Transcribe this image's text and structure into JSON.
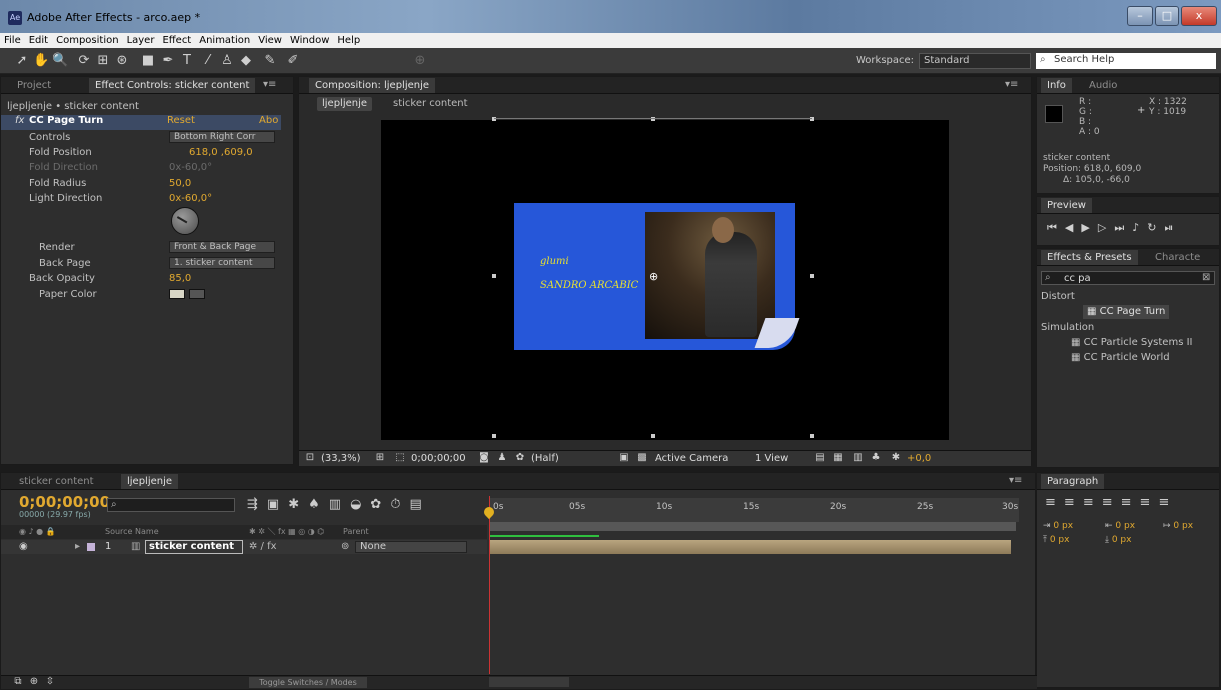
{
  "window": {
    "title": "Adobe After Effects - arco.aep *",
    "app_icon": "Ae"
  },
  "window_controls": {
    "minimize": "–",
    "maximize": "□",
    "close": "x"
  },
  "menu": [
    "File",
    "Edit",
    "Composition",
    "Layer",
    "Effect",
    "Animation",
    "View",
    "Window",
    "Help"
  ],
  "toolbar": {
    "workspace_label": "Workspace:",
    "workspace_value": "Standard",
    "search_placeholder": "Search Help"
  },
  "left_panel": {
    "tabs": [
      "Project",
      "Effect Controls: sticker content"
    ],
    "breadcrumb": "ljepljenje • sticker content",
    "effect": {
      "fx_label": "fx",
      "name": "CC Page Turn",
      "reset": "Reset",
      "about": "Abo"
    },
    "properties": [
      {
        "label": "Controls",
        "value": "Bottom Right Corr"
      },
      {
        "label": "Fold Position",
        "value": "618,0 ,609,0"
      },
      {
        "label": "Fold Direction",
        "value": "0x-60,0°"
      },
      {
        "label": "Fold Radius",
        "value": "50,0"
      },
      {
        "label": "Light Direction",
        "value": "0x-60,0°"
      },
      {
        "label": "Render",
        "value": "Front & Back Page"
      },
      {
        "label": "Back Page",
        "value": "1. sticker content"
      },
      {
        "label": "Back Opacity",
        "value": "85,0"
      },
      {
        "label": "Paper Color",
        "value": ""
      }
    ]
  },
  "composition": {
    "tab": "Composition: ljepljenje",
    "breadcrumb": [
      "ljepljenje",
      "sticker content"
    ],
    "sticker_text_1": "glumi",
    "sticker_text_2": "SANDRO ARCABIC",
    "footer": {
      "zoom": "(33,3%)",
      "timecode": "0;00;00;00",
      "resolution": "(Half)",
      "camera": "Active Camera",
      "view": "1 View",
      "exposure": "+0,0"
    }
  },
  "info_panel": {
    "tabs": [
      "Info",
      "Audio"
    ],
    "rgb": [
      "R :",
      "G :",
      "B :",
      "A : 0"
    ],
    "coords": {
      "x": "X : 1322",
      "y": "Y : 1019"
    },
    "layer": "sticker content",
    "position": "Position: 618,0, 609,0",
    "delta": "Δ: 105,0, -66,0"
  },
  "preview_panel": {
    "tab": "Preview"
  },
  "effects_panel": {
    "tabs": [
      "Effects & Presets",
      "Characte"
    ],
    "search_value": "cc pa",
    "categories": [
      {
        "name": "Distort",
        "items": [
          "CC Page Turn"
        ]
      },
      {
        "name": "Simulation",
        "items": [
          "CC Particle Systems II",
          "CC Particle World"
        ]
      }
    ]
  },
  "paragraph_panel": {
    "tab": "Paragraph",
    "values": [
      "0 px",
      "0 px",
      "0 px",
      "0 px",
      "0 px"
    ]
  },
  "timeline": {
    "tabs": [
      "sticker content",
      "ljepljenje"
    ],
    "timecode": "0;00;00;00",
    "fps": "00000 (29.97 fps)",
    "columns": {
      "source": "Source Name",
      "parent": "Parent"
    },
    "layer": {
      "index": "1",
      "name": "sticker content",
      "parent": "None"
    },
    "ruler_marks": [
      "0s",
      "05s",
      "10s",
      "15s",
      "20s",
      "25s",
      "30s"
    ],
    "toggle_label": "Toggle Switches / Modes"
  }
}
